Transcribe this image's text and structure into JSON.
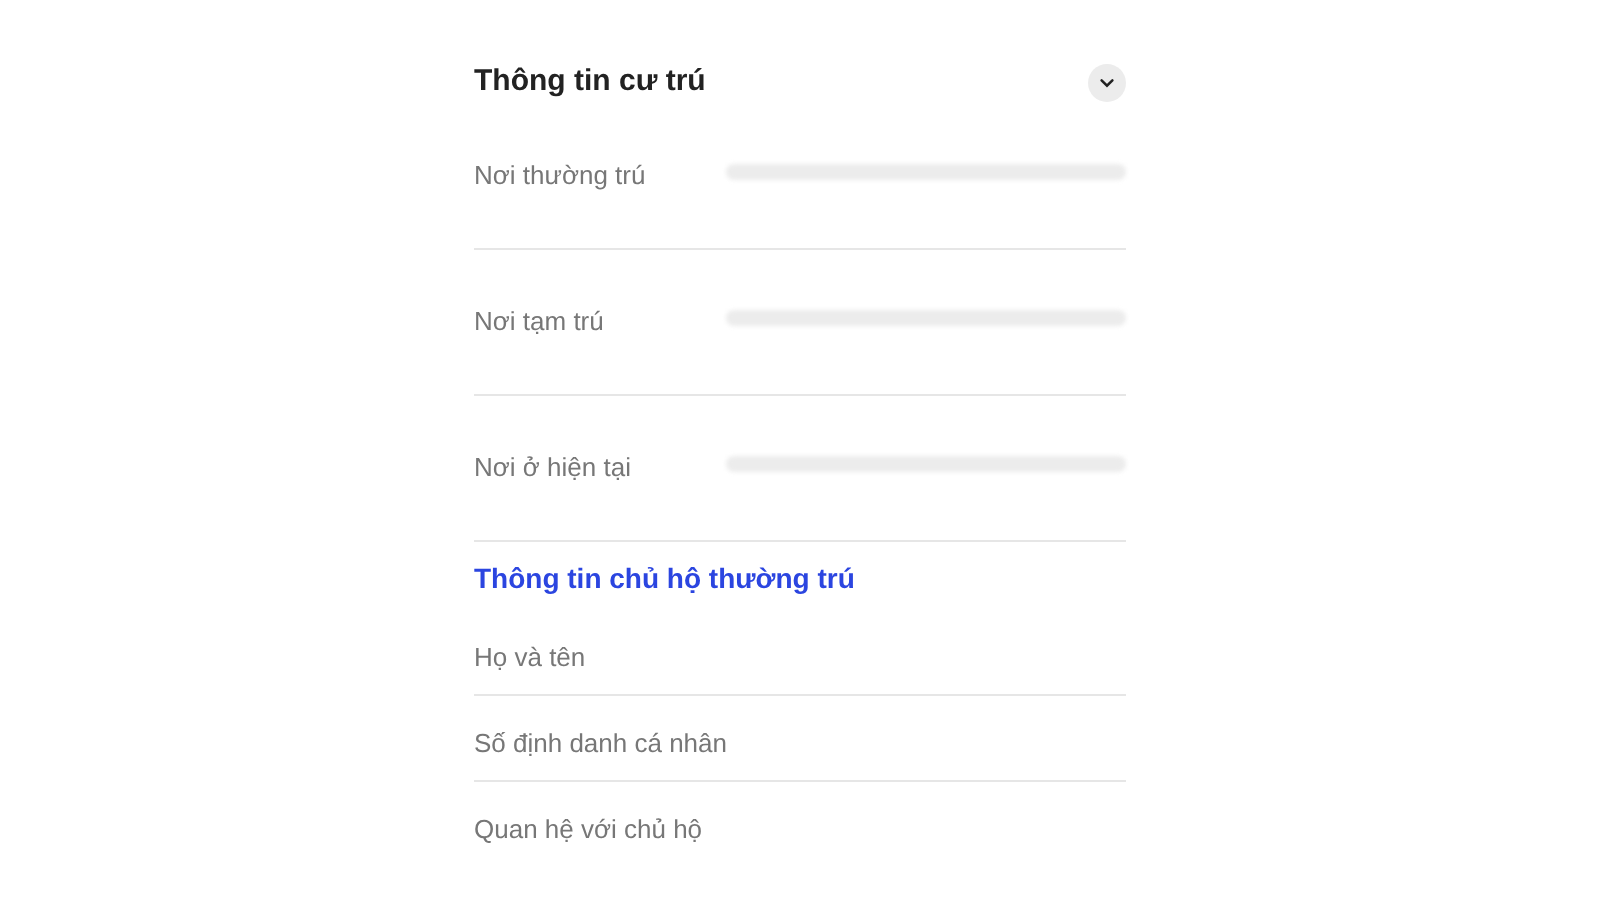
{
  "residence_section": {
    "title": "Thông tin cư trú",
    "expanded": true,
    "rows": [
      {
        "label": "Nơi thường trú"
      },
      {
        "label": "Nơi tạm trú"
      },
      {
        "label": "Nơi ở hiện tại"
      }
    ]
  },
  "household_head_section": {
    "title": "Thông tin chủ hộ thường trú",
    "rows": [
      {
        "label": "Họ và tên"
      },
      {
        "label": "Số định danh cá nhân"
      },
      {
        "label": "Quan hệ với chủ hộ"
      }
    ]
  }
}
